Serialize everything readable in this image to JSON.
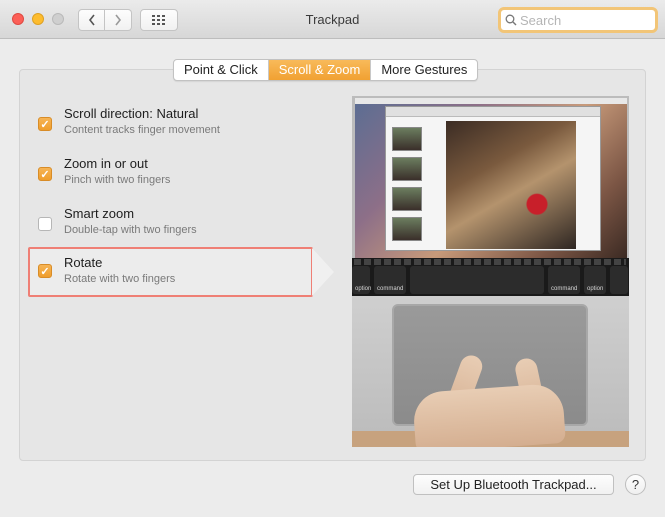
{
  "window": {
    "title": "Trackpad"
  },
  "toolbar": {
    "back_icon": "chevron-left-icon",
    "forward_icon": "chevron-right-icon",
    "grid_icon": "grid-icon"
  },
  "search": {
    "placeholder": "Search",
    "value": ""
  },
  "tabs": [
    {
      "label": "Point & Click",
      "active": false
    },
    {
      "label": "Scroll & Zoom",
      "active": true
    },
    {
      "label": "More Gestures",
      "active": false
    }
  ],
  "options": [
    {
      "title": "Scroll direction: Natural",
      "subtitle": "Content tracks finger movement",
      "checked": true
    },
    {
      "title": "Zoom in or out",
      "subtitle": "Pinch with two fingers",
      "checked": true
    },
    {
      "title": "Smart zoom",
      "subtitle": "Double-tap with two fingers",
      "checked": false
    },
    {
      "title": "Rotate",
      "subtitle": "Rotate with two fingers",
      "checked": true,
      "selected": true
    }
  ],
  "illustration": {
    "keys": [
      "option",
      "command",
      "command",
      "option"
    ]
  },
  "footer": {
    "setup_label": "Set Up Bluetooth Trackpad...",
    "help_label": "?"
  },
  "colors": {
    "accent": "#f1a132",
    "selection_border": "#ef7f75"
  }
}
